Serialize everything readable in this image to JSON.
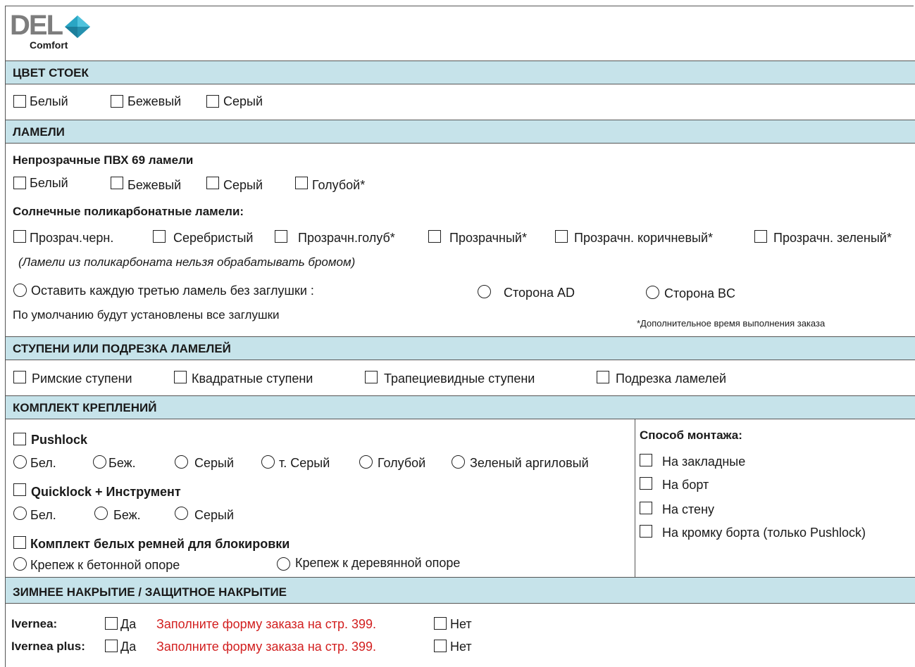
{
  "logo": {
    "brand": "DEL",
    "sub": "Comfort"
  },
  "sections": {
    "post_color": "ЦВЕТ СТОЕК",
    "slats": "ЛАМЕЛИ",
    "steps": "СТУПЕНИ ИЛИ ПОДРЕЗКА ЛАМЕЛЕЙ",
    "fixing": "КОМПЛЕКТ КРЕПЛЕНИЙ",
    "winter": "ЗИМНЕЕ НАКРЫТИЕ / ЗАЩИТНОЕ НАКРЫТИЕ"
  },
  "post_color": {
    "white": "Белый",
    "beige": "Бежевый",
    "grey": "Серый"
  },
  "opaque": {
    "heading": "Непрозрачные ПВХ 69 ламели",
    "white": "Белый",
    "beige": "Бежевый",
    "grey": "Серый",
    "blue": "Голубой*"
  },
  "solar": {
    "heading": "Солнечные поликарбонатные ламели:",
    "o1": "Прозрач.черн.",
    "o2": "Серебристый",
    "o3": "Прозрачн.голуб*",
    "o4": "Прозрачный*",
    "o5": "Прозрачн. коричневый*",
    "o6": "Прозрачн. зеленый*",
    "note": "(Ламели из поликарбоната нельзя обрабатывать бромом)"
  },
  "caps": {
    "leave": "Оставить каждую третью ламель без заглушки :",
    "side_ad": "Сторона AD",
    "side_bc": "Сторона BC",
    "default": "По умолчанию будут установлены все заглушки",
    "extra_time": "*Дополнительное время выполнения заказа"
  },
  "steps": {
    "roman": "Римские ступени",
    "square": "Квадратные ступени",
    "trap": "Трапециевидные ступени",
    "cut": "Подрезка ламелей"
  },
  "pushlock": {
    "label": "Pushlock",
    "c1": "Бел.",
    "c2": "Беж.",
    "c3": "Серый",
    "c4": "т. Серый",
    "c5": "Голубой",
    "c6": "Зеленый аргиловый"
  },
  "quicklock": {
    "label": "Quicklock + Инструмент",
    "c1": "Бел.",
    "c2": "Беж.",
    "c3": "Серый"
  },
  "straps": {
    "label": "Комплект белых ремней для блокировки",
    "concrete": "Крепеж к бетонной опоре",
    "wood": "Крепеж к деревянной опоре"
  },
  "mounting": {
    "heading": "Способ монтажа:",
    "m1": "На закладные",
    "m2": "На борт",
    "m3": "На стену",
    "m4": "На кромку борта (только Pushlock)"
  },
  "winter": {
    "ivernea": "Ivernea:",
    "ivernea_plus": "Ivernea plus:",
    "yes": "Да",
    "no": "Нет",
    "fill": "Заполните форму заказа на стр. 399."
  },
  "colors": {
    "band": "#c6e3ea",
    "accent_red": "#d21f1f",
    "logo_grey": "#7d7d7d"
  }
}
